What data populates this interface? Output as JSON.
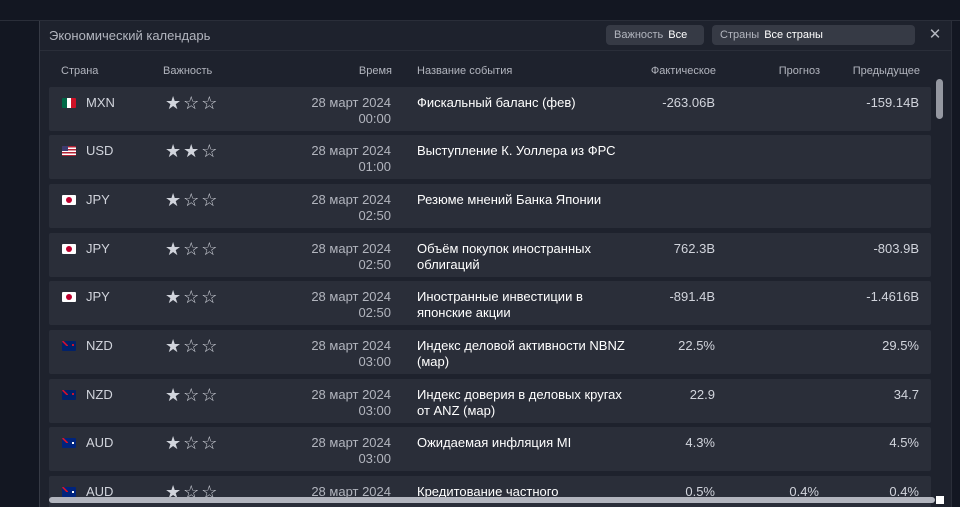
{
  "window": {
    "title": "Экономический календарь"
  },
  "filters": {
    "importance_label": "Важность",
    "importance_value": "Все",
    "countries_label": "Страны",
    "countries_value": "Все страны"
  },
  "columns": {
    "country": "Страна",
    "importance": "Важность",
    "time": "Время",
    "event": "Название события",
    "actual": "Фактическое",
    "forecast": "Прогноз",
    "previous": "Предыдущее"
  },
  "rows": [
    {
      "flag": "mx-flag-icon",
      "currency": "MXN",
      "stars": "★☆☆",
      "importance": 1,
      "date": "28 март 2024",
      "time": "00:00",
      "event": "Фискальный баланс (фев)",
      "actual": "-263.06B",
      "forecast": "",
      "previous": "-159.14B"
    },
    {
      "flag": "us-flag-icon",
      "currency": "USD",
      "stars": "★★☆",
      "importance": 2,
      "date": "28 март 2024",
      "time": "01:00",
      "event": "Выступление К. Уоллера из ФРС",
      "actual": "",
      "forecast": "",
      "previous": ""
    },
    {
      "flag": "jp-flag-icon",
      "currency": "JPY",
      "stars": "★☆☆",
      "importance": 1,
      "date": "28 март 2024",
      "time": "02:50",
      "event": "Резюме мнений Банка Японии",
      "actual": "",
      "forecast": "",
      "previous": ""
    },
    {
      "flag": "jp-flag-icon",
      "currency": "JPY",
      "stars": "★☆☆",
      "importance": 1,
      "date": "28 март 2024",
      "time": "02:50",
      "event": "Объём покупок иностранных облигаций",
      "actual": "762.3B",
      "forecast": "",
      "previous": "-803.9B"
    },
    {
      "flag": "jp-flag-icon",
      "currency": "JPY",
      "stars": "★☆☆",
      "importance": 1,
      "date": "28 март 2024",
      "time": "02:50",
      "event": "Иностранные инвестиции в японские акции",
      "actual": "-891.4B",
      "forecast": "",
      "previous": "-1.4616B"
    },
    {
      "flag": "nz-flag-icon",
      "currency": "NZD",
      "stars": "★☆☆",
      "importance": 1,
      "date": "28 март 2024",
      "time": "03:00",
      "event": "Индекс деловой активности NBNZ (мар)",
      "actual": "22.5%",
      "forecast": "",
      "previous": "29.5%"
    },
    {
      "flag": "nz-flag-icon",
      "currency": "NZD",
      "stars": "★☆☆",
      "importance": 1,
      "date": "28 март 2024",
      "time": "03:00",
      "event": "Индекс доверия в деловых кругах от ANZ (мар)",
      "actual": "22.9",
      "forecast": "",
      "previous": "34.7"
    },
    {
      "flag": "au-flag-icon",
      "currency": "AUD",
      "stars": "★☆☆",
      "importance": 1,
      "date": "28 март 2024",
      "time": "03:00",
      "event": "Ожидаемая инфляция MI",
      "actual": "4.3%",
      "forecast": "",
      "previous": "4.5%"
    },
    {
      "flag": "au-flag-icon",
      "currency": "AUD",
      "stars": "★☆☆",
      "importance": 1,
      "date": "28 март 2024",
      "time": "",
      "event": "Кредитование частного",
      "actual": "0.5%",
      "forecast": "0.4%",
      "previous": "0.4%"
    }
  ]
}
